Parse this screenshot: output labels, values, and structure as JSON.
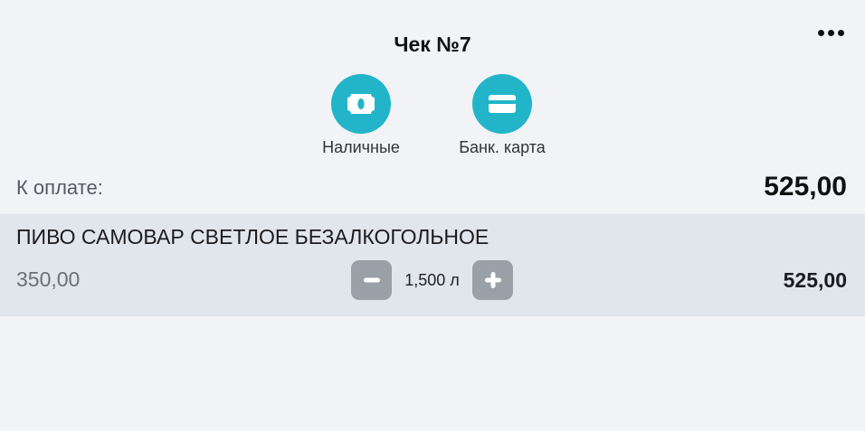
{
  "header": {
    "title": "Чек №7",
    "more_icon": "more-horizontal-icon"
  },
  "payment_methods": [
    {
      "label": "Наличные",
      "icon": "cash-icon"
    },
    {
      "label": "Банк. карта",
      "icon": "credit-card-icon"
    }
  ],
  "summary": {
    "due_label": "К оплате:",
    "due_value": "525,00"
  },
  "items": [
    {
      "name": "ПИВО САМОВАР СВЕТЛОЕ БЕЗАЛКОГОЛЬНОЕ",
      "price": "350,00",
      "quantity": "1,500 л",
      "total": "525,00",
      "decrement_icon": "minus-icon",
      "increment_icon": "plus-icon"
    }
  ],
  "colors": {
    "accent": "#22b5c9",
    "background": "#f2f3f7",
    "row_background": "#e1e5ec",
    "stepper_button": "#9aa0a8"
  }
}
